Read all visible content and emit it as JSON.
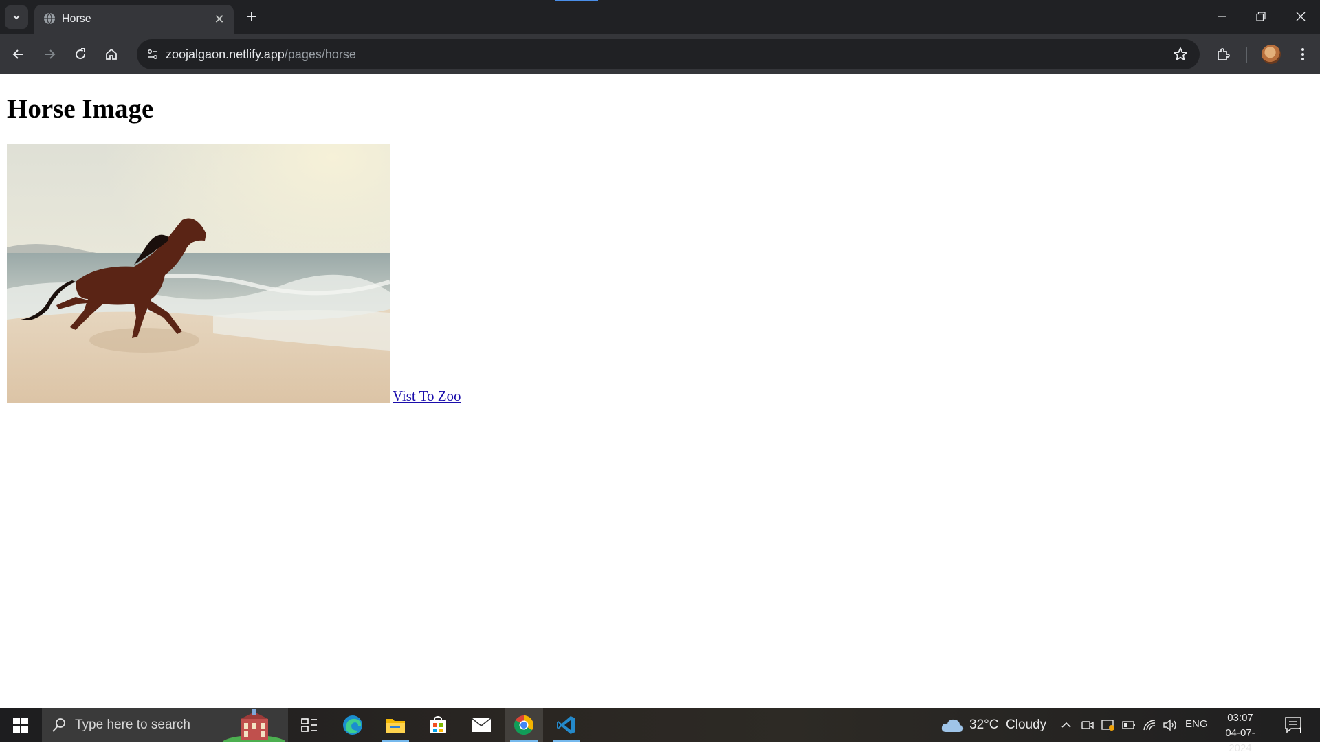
{
  "browser": {
    "tab_title": "Horse",
    "url_domain": "zoojalgaon.netlify.app",
    "url_path": "/pages/horse"
  },
  "page": {
    "heading": "Horse Image",
    "image_alt": "horse galloping on beach",
    "link_text": "Vist To Zoo"
  },
  "taskbar": {
    "search_placeholder": "Type here to search",
    "weather": "32°C  Cloudy",
    "language": "ENG",
    "time": "03:07",
    "date": "04-07-2024",
    "notification_count": "1"
  },
  "colors": {
    "chrome_dark": "#202124",
    "chrome_toolbar": "#35363a",
    "link": "#1a0dab",
    "taskbar_accent": "#76b9ed"
  }
}
